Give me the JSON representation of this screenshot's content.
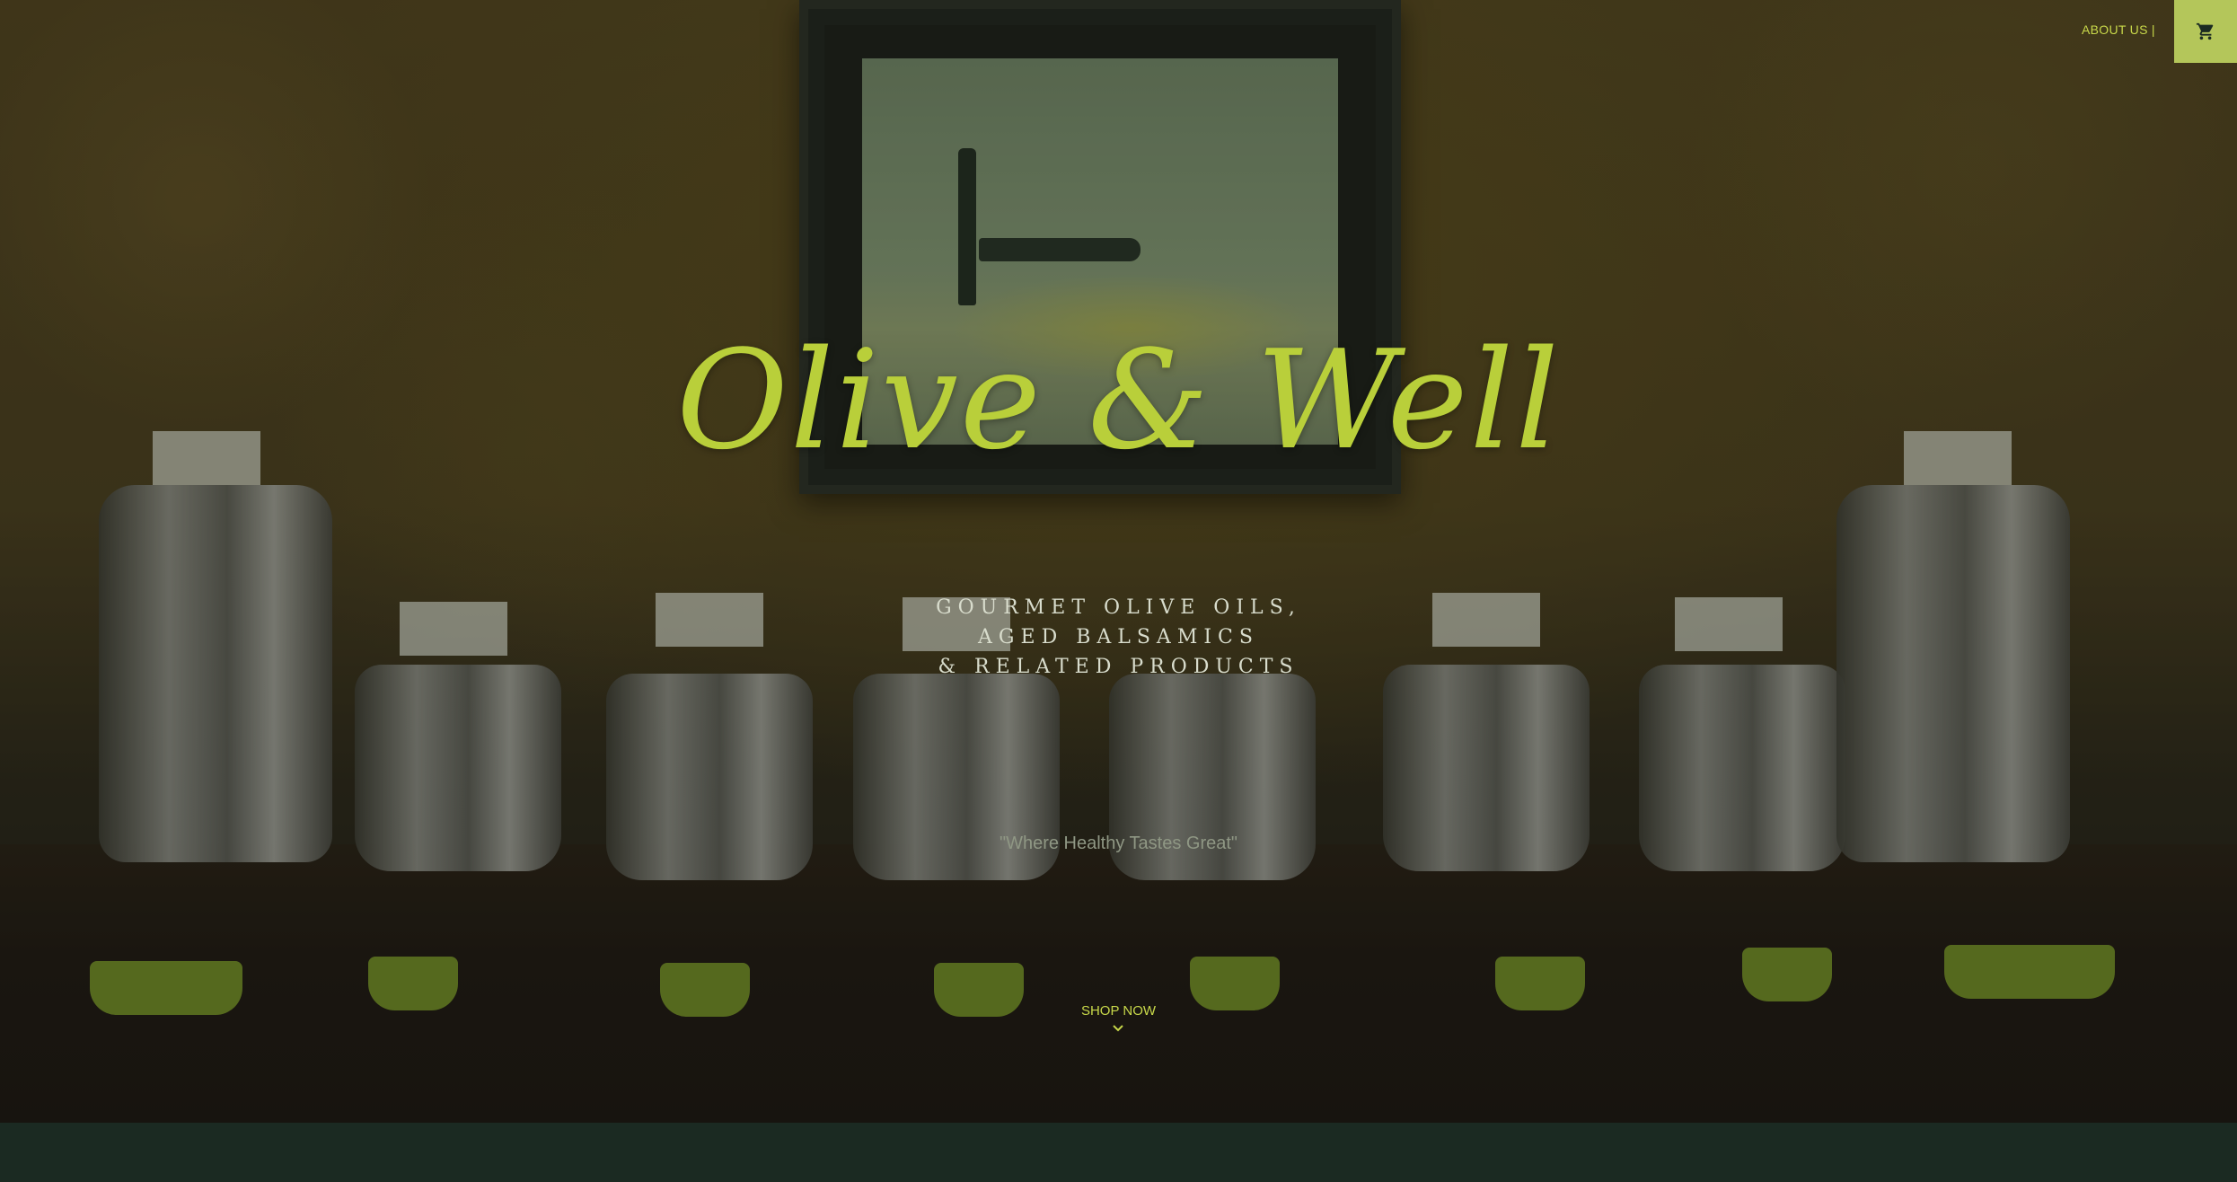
{
  "header": {
    "nav_about": "ABOUT US |",
    "cart_icon": "cart-icon"
  },
  "hero": {
    "logo_text": "Olive & Well",
    "tagline": [
      "GOURMET OLIVE OILS,",
      "AGED BALSAMICS",
      "& RELATED PRODUCTS"
    ],
    "motto": "\"Where Healthy Tastes Great\"",
    "cta_label": "SHOP NOW",
    "cta_icon": "chevron-down-icon"
  },
  "colors": {
    "accent": "#c8d84a",
    "logo": "#b9cf3a",
    "cart_bg": "#b4c65a",
    "footer": "#1b2a22"
  }
}
